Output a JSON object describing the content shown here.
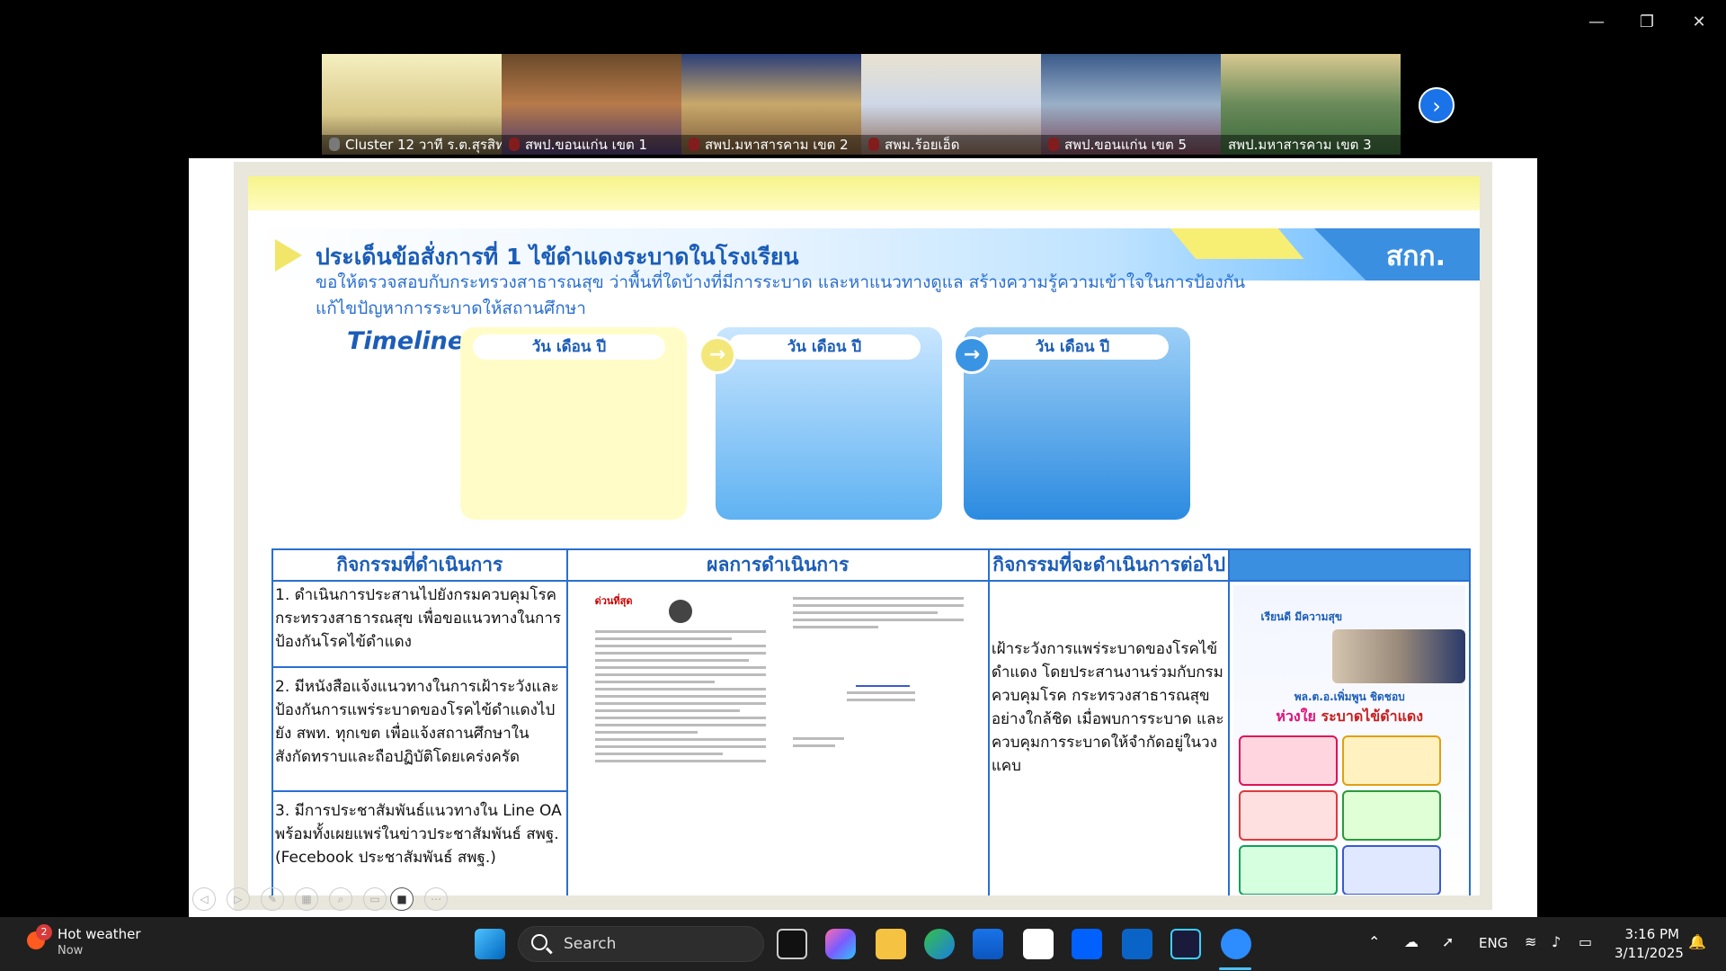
{
  "window_controls": {
    "minimize": "—",
    "restore": "❐",
    "close": "✕"
  },
  "participants": [
    {
      "name": "Cluster 12 วาที ร.ต.สุรสิท...",
      "active": true,
      "mic": "pinned"
    },
    {
      "name": "สพป.ขอนแก่น เขต 1",
      "active": false,
      "mic": "muted"
    },
    {
      "name": "สพป.มหาสารคาม เขต 2",
      "active": false,
      "mic": "muted"
    },
    {
      "name": "สพม.ร้อยเอ็ด",
      "active": false,
      "mic": "muted"
    },
    {
      "name": "สพป.ขอนแก่น เขต 5",
      "active": false,
      "mic": "muted"
    },
    {
      "name": "สพป.มหาสารคาม เขต 3",
      "active": false,
      "mic": "none"
    }
  ],
  "slide": {
    "org": "สกก.",
    "title": "ประเด็นข้อสั่งการที่ 1  ไข้ดำแดงระบาดในโรงเรียน",
    "subtitle": "ขอให้ตรวจสอบกับกระทรวงสาธารณสุข ว่าพื้นที่ใดบ้างที่มีการระบาด และหาแนวทางดูแล สร้างความรู้ความเข้าใจในการป้องกัน แก้ไขปัญหาการระบาดให้สถานศึกษา",
    "timeline_label": "Timeline",
    "timeline_heads": [
      "วัน เดือน ปี",
      "วัน เดือน ปี",
      "วัน เดือน ปี"
    ],
    "table": {
      "headers": [
        "กิจกรรมที่ดำเนินการ",
        "ผลการดำเนินการ",
        "กิจกรรมที่จะดำเนินการต่อไป",
        ""
      ],
      "activities": [
        "1. ดำเนินการประสานไปยังกรมควบคุมโรค กระทรวงสาธารณสุข เพื่อขอแนวทางในการป้องกันโรคไข้ดำแดง",
        "2. มีหนังสือแจ้งแนวทางในการเฝ้าระวังและป้องกันการแพร่ระบาดของโรคไข้ดำแดงไปยัง สพท. ทุกเขต เพื่อแจ้งสถานศึกษาในสังกัดทราบและถือปฏิบัติโดยเคร่งครัด",
        "3. มีการประชาสัมพันธ์แนวทางใน Line OA พร้อมทั้งเผยแพร่ในข่าวประชาสัมพันธ์ สพฐ. (Fecebook ประชาสัมพันธ์ สพฐ.)"
      ],
      "doc_header": "ด่วนที่สุด",
      "next_activity": "เฝ้าระวังการแพร่ระบาดของโรคไข้ดำแดง โดยประสานงานร่วมกับกรมควบคุมโรค กระทรวงสาธารณสุขอย่างใกล้ชิด เมื่อพบการระบาด และควบคุมการระบาดให้จำกัดอยู่ในวงแคบ",
      "poster": {
        "greeting": "เรียนดี มีความสุข",
        "minister": "พล.ต.อ.เพิ่มพูน ชิดชอบ",
        "headline_a": "ห่วงใย",
        "headline_b": "ระบาดไข้ดำแดง"
      }
    }
  },
  "taskbar": {
    "weather_title": "Hot weather",
    "weather_sub": "Now",
    "weather_badge": "2",
    "search_placeholder": "Search",
    "lang": "ENG",
    "time": "3:16 PM",
    "date": "3/11/2025"
  },
  "colors": {
    "accent_blue": "#1b5db8",
    "zoom_blue": "#2d8cff",
    "active_green": "#2ecc71"
  }
}
